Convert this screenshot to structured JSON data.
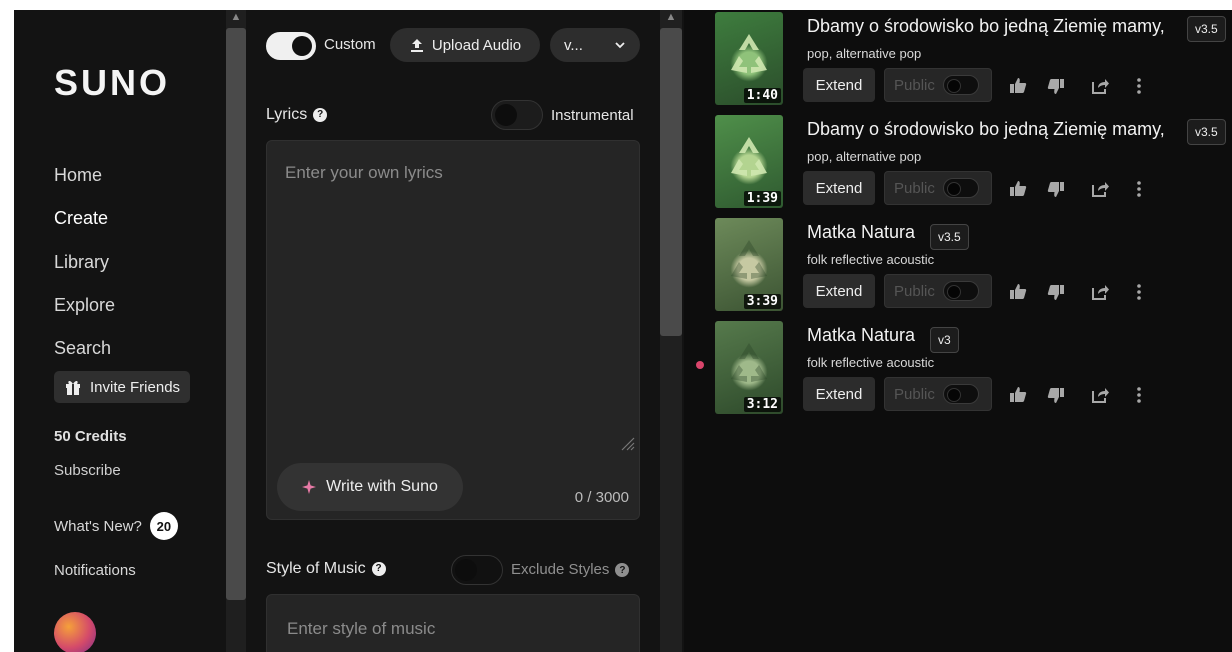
{
  "sidebar": {
    "logo": "SUNO",
    "nav": [
      {
        "label": "Home"
      },
      {
        "label": "Create"
      },
      {
        "label": "Library"
      },
      {
        "label": "Explore"
      },
      {
        "label": "Search"
      }
    ],
    "invite_label": "Invite Friends",
    "credits": "50 Credits",
    "subscribe": "Subscribe",
    "whats_new": "What's New?",
    "whats_new_count": "20",
    "notifications": "Notifications"
  },
  "create": {
    "custom_label": "Custom",
    "custom_on": true,
    "upload_label": "Upload Audio",
    "version_select": "v...",
    "lyrics_label": "Lyrics",
    "instrumental_label": "Instrumental",
    "lyrics_placeholder": "Enter your own lyrics",
    "write_label": "Write with Suno",
    "counter": "0 / 3000",
    "style_label": "Style of Music",
    "exclude_label": "Exclude Styles",
    "style_placeholder": "Enter style of music"
  },
  "songs": [
    {
      "title": "Dbamy o środowisko bo jedną Ziemię mamy,",
      "version": "v3.5",
      "genre": "pop, alternative pop",
      "duration": "1:40",
      "extend": "Extend",
      "public": "Public",
      "thumb_colors": [
        "#3e7d3e",
        "#8fc27a",
        "#2b4d2b"
      ]
    },
    {
      "title": "Dbamy o środowisko bo jedną Ziemię mamy,",
      "version": "v3.5",
      "genre": "pop, alternative pop",
      "duration": "1:39",
      "extend": "Extend",
      "public": "Public",
      "thumb_colors": [
        "#4f8f4a",
        "#b3d490",
        "#2f5a30"
      ]
    },
    {
      "title": "Matka Natura",
      "version": "v3.5",
      "genre": "folk reflective acoustic",
      "duration": "3:39",
      "extend": "Extend",
      "public": "Public",
      "thumb_colors": [
        "#6d8a5a",
        "#c6c9a2",
        "#3c5433"
      ]
    },
    {
      "title": "Matka Natura",
      "version": "v3",
      "genre": "folk reflective acoustic",
      "duration": "3:12",
      "extend": "Extend",
      "public": "Public",
      "thumb_colors": [
        "#567a4c",
        "#9fb98a",
        "#2e4a2b"
      ]
    }
  ],
  "colors": {
    "accent_pink": "#d9456b",
    "panel_bg": "#131313",
    "library_bg": "#0d0d0d"
  }
}
